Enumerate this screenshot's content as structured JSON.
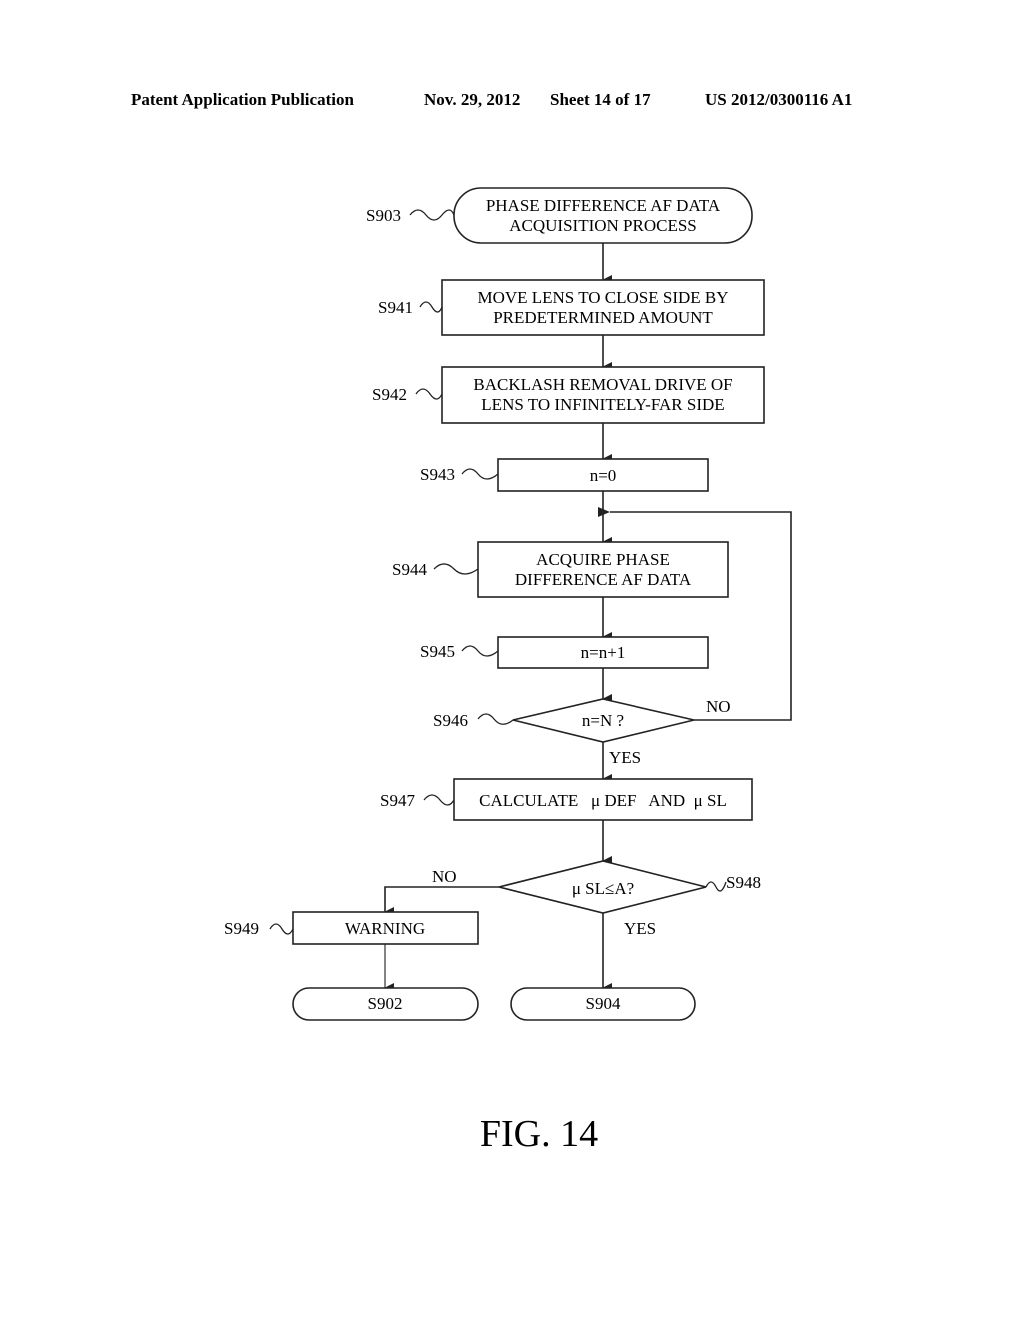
{
  "header": {
    "publication": "Patent Application Publication",
    "date": "Nov. 29, 2012",
    "sheet": "Sheet 14 of 17",
    "number": "US 2012/0300116 A1"
  },
  "flowchart": {
    "start": {
      "id": "S903",
      "lines": [
        "PHASE DIFFERENCE AF DATA",
        "ACQUISITION PROCESS"
      ]
    },
    "steps": [
      {
        "id": "S941",
        "lines": [
          "MOVE LENS TO CLOSE SIDE BY",
          "PREDETERMINED AMOUNT"
        ]
      },
      {
        "id": "S942",
        "lines": [
          "BACKLASH REMOVAL DRIVE OF",
          "LENS TO INFINITELY-FAR SIDE"
        ]
      },
      {
        "id": "S943",
        "lines": [
          "n=0"
        ]
      },
      {
        "id": "S944",
        "lines": [
          "ACQUIRE PHASE",
          "DIFFERENCE AF DATA"
        ]
      },
      {
        "id": "S945",
        "lines": [
          "n=n+1"
        ]
      },
      {
        "id": "S946",
        "lines": [
          "n=N ?"
        ],
        "type": "decision",
        "yes": "YES",
        "no": "NO"
      },
      {
        "id": "S947",
        "lines": [
          "CALCULATE   μ DEF   AND  μ SL"
        ]
      },
      {
        "id": "S948",
        "lines": [
          "μ SL≤A?"
        ],
        "type": "decision",
        "yes": "YES",
        "no": "NO"
      },
      {
        "id": "S949",
        "lines": [
          "WARNING"
        ]
      }
    ],
    "ends": [
      {
        "id": "S902",
        "label": "S902"
      },
      {
        "id": "S904",
        "label": "S904"
      }
    ]
  },
  "figure_label": "FIG. 14"
}
